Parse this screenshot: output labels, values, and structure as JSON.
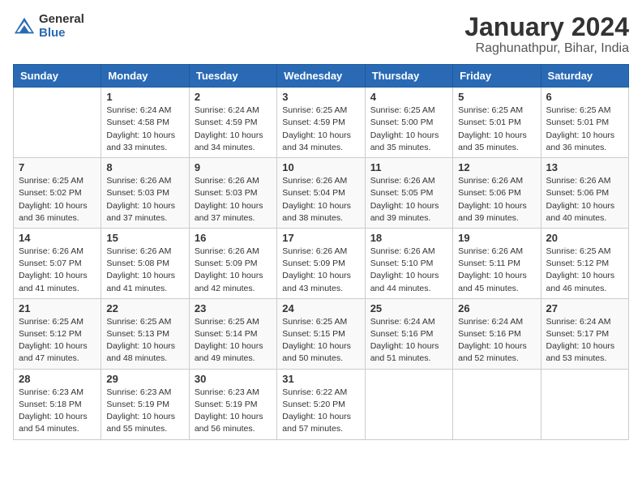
{
  "header": {
    "logo_general": "General",
    "logo_blue": "Blue",
    "month_title": "January 2024",
    "location": "Raghunathpur, Bihar, India"
  },
  "days_of_week": [
    "Sunday",
    "Monday",
    "Tuesday",
    "Wednesday",
    "Thursday",
    "Friday",
    "Saturday"
  ],
  "weeks": [
    [
      {
        "day": "",
        "info": ""
      },
      {
        "day": "1",
        "info": "Sunrise: 6:24 AM\nSunset: 4:58 PM\nDaylight: 10 hours\nand 33 minutes."
      },
      {
        "day": "2",
        "info": "Sunrise: 6:24 AM\nSunset: 4:59 PM\nDaylight: 10 hours\nand 34 minutes."
      },
      {
        "day": "3",
        "info": "Sunrise: 6:25 AM\nSunset: 4:59 PM\nDaylight: 10 hours\nand 34 minutes."
      },
      {
        "day": "4",
        "info": "Sunrise: 6:25 AM\nSunset: 5:00 PM\nDaylight: 10 hours\nand 35 minutes."
      },
      {
        "day": "5",
        "info": "Sunrise: 6:25 AM\nSunset: 5:01 PM\nDaylight: 10 hours\nand 35 minutes."
      },
      {
        "day": "6",
        "info": "Sunrise: 6:25 AM\nSunset: 5:01 PM\nDaylight: 10 hours\nand 36 minutes."
      }
    ],
    [
      {
        "day": "7",
        "info": "Sunrise: 6:25 AM\nSunset: 5:02 PM\nDaylight: 10 hours\nand 36 minutes."
      },
      {
        "day": "8",
        "info": "Sunrise: 6:26 AM\nSunset: 5:03 PM\nDaylight: 10 hours\nand 37 minutes."
      },
      {
        "day": "9",
        "info": "Sunrise: 6:26 AM\nSunset: 5:03 PM\nDaylight: 10 hours\nand 37 minutes."
      },
      {
        "day": "10",
        "info": "Sunrise: 6:26 AM\nSunset: 5:04 PM\nDaylight: 10 hours\nand 38 minutes."
      },
      {
        "day": "11",
        "info": "Sunrise: 6:26 AM\nSunset: 5:05 PM\nDaylight: 10 hours\nand 39 minutes."
      },
      {
        "day": "12",
        "info": "Sunrise: 6:26 AM\nSunset: 5:06 PM\nDaylight: 10 hours\nand 39 minutes."
      },
      {
        "day": "13",
        "info": "Sunrise: 6:26 AM\nSunset: 5:06 PM\nDaylight: 10 hours\nand 40 minutes."
      }
    ],
    [
      {
        "day": "14",
        "info": "Sunrise: 6:26 AM\nSunset: 5:07 PM\nDaylight: 10 hours\nand 41 minutes."
      },
      {
        "day": "15",
        "info": "Sunrise: 6:26 AM\nSunset: 5:08 PM\nDaylight: 10 hours\nand 41 minutes."
      },
      {
        "day": "16",
        "info": "Sunrise: 6:26 AM\nSunset: 5:09 PM\nDaylight: 10 hours\nand 42 minutes."
      },
      {
        "day": "17",
        "info": "Sunrise: 6:26 AM\nSunset: 5:09 PM\nDaylight: 10 hours\nand 43 minutes."
      },
      {
        "day": "18",
        "info": "Sunrise: 6:26 AM\nSunset: 5:10 PM\nDaylight: 10 hours\nand 44 minutes."
      },
      {
        "day": "19",
        "info": "Sunrise: 6:26 AM\nSunset: 5:11 PM\nDaylight: 10 hours\nand 45 minutes."
      },
      {
        "day": "20",
        "info": "Sunrise: 6:25 AM\nSunset: 5:12 PM\nDaylight: 10 hours\nand 46 minutes."
      }
    ],
    [
      {
        "day": "21",
        "info": "Sunrise: 6:25 AM\nSunset: 5:12 PM\nDaylight: 10 hours\nand 47 minutes."
      },
      {
        "day": "22",
        "info": "Sunrise: 6:25 AM\nSunset: 5:13 PM\nDaylight: 10 hours\nand 48 minutes."
      },
      {
        "day": "23",
        "info": "Sunrise: 6:25 AM\nSunset: 5:14 PM\nDaylight: 10 hours\nand 49 minutes."
      },
      {
        "day": "24",
        "info": "Sunrise: 6:25 AM\nSunset: 5:15 PM\nDaylight: 10 hours\nand 50 minutes."
      },
      {
        "day": "25",
        "info": "Sunrise: 6:24 AM\nSunset: 5:16 PM\nDaylight: 10 hours\nand 51 minutes."
      },
      {
        "day": "26",
        "info": "Sunrise: 6:24 AM\nSunset: 5:16 PM\nDaylight: 10 hours\nand 52 minutes."
      },
      {
        "day": "27",
        "info": "Sunrise: 6:24 AM\nSunset: 5:17 PM\nDaylight: 10 hours\nand 53 minutes."
      }
    ],
    [
      {
        "day": "28",
        "info": "Sunrise: 6:23 AM\nSunset: 5:18 PM\nDaylight: 10 hours\nand 54 minutes."
      },
      {
        "day": "29",
        "info": "Sunrise: 6:23 AM\nSunset: 5:19 PM\nDaylight: 10 hours\nand 55 minutes."
      },
      {
        "day": "30",
        "info": "Sunrise: 6:23 AM\nSunset: 5:19 PM\nDaylight: 10 hours\nand 56 minutes."
      },
      {
        "day": "31",
        "info": "Sunrise: 6:22 AM\nSunset: 5:20 PM\nDaylight: 10 hours\nand 57 minutes."
      },
      {
        "day": "",
        "info": ""
      },
      {
        "day": "",
        "info": ""
      },
      {
        "day": "",
        "info": ""
      }
    ]
  ]
}
